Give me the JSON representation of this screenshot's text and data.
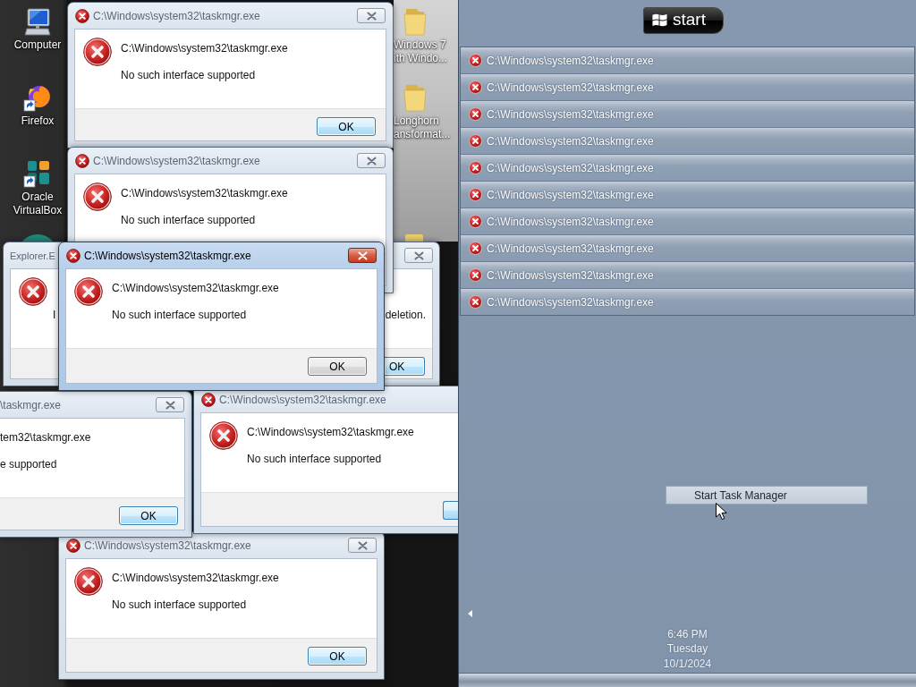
{
  "desktop": {
    "icons": [
      {
        "kind": "computer",
        "label": "Computer"
      },
      {
        "kind": "firefox",
        "label": "Firefox"
      },
      {
        "kind": "virtualbox",
        "label": "Oracle VirtualBox"
      },
      {
        "kind": "app-edge"
      },
      {
        "kind": "folder",
        "label_lines": [
          "Windows 7",
          "ith Windo..."
        ]
      },
      {
        "kind": "folder",
        "label_lines": [
          "Longhorn",
          "ansformat..."
        ]
      },
      {
        "kind": "folder-edge"
      }
    ]
  },
  "dialogs": [
    {
      "kind": "error",
      "active": false,
      "title": "C:\\Windows\\system32\\taskmgr.exe",
      "heading": "C:\\Windows\\system32\\taskmgr.exe",
      "message": "No such interface supported",
      "button": "OK"
    },
    {
      "kind": "error",
      "active": false,
      "title": "C:\\Windows\\system32\\taskmgr.exe",
      "heading": "C:\\Windows\\system32\\taskmgr.exe",
      "message": "No such interface supported"
    },
    {
      "kind": "explorer",
      "active": false,
      "title": "Explorer.E",
      "message_left": "I",
      "message_right": "deletion.",
      "button": "OK"
    },
    {
      "kind": "error",
      "active": true,
      "title": "C:\\Windows\\system32\\taskmgr.exe",
      "heading": "C:\\Windows\\system32\\taskmgr.exe",
      "message": "No such interface supported",
      "button": "OK"
    },
    {
      "kind": "clipped-left",
      "active": false,
      "title": "\\taskmgr.exe",
      "heading": "tem32\\taskmgr.exe",
      "message": "e supported",
      "button": "OK"
    },
    {
      "kind": "clipped-right",
      "active": false,
      "title": "C:\\Windows\\system32\\taskmgr.exe",
      "heading": "C:\\Windows\\system32\\taskmgr.exe",
      "message": "No such interface supported"
    },
    {
      "kind": "error",
      "active": false,
      "title": "C:\\Windows\\system32\\taskmgr.exe",
      "heading": "C:\\Windows\\system32\\taskmgr.exe",
      "message": "No such interface supported",
      "button": "OK"
    }
  ],
  "side_panel": {
    "start_button": "start",
    "items": [
      {
        "label": "C:\\Windows\\system32\\taskmgr.exe",
        "selected": false
      },
      {
        "label": "C:\\Windows\\system32\\taskmgr.exe",
        "selected": false
      },
      {
        "label": "C:\\Windows\\system32\\taskmgr.exe",
        "selected": false
      },
      {
        "label": "C:\\Windows\\system32\\taskmgr.exe",
        "selected": false
      },
      {
        "label": "C:\\Windows\\system32\\taskmgr.exe",
        "selected": false
      },
      {
        "label": "C:\\Windows\\system32\\taskmgr.exe",
        "selected": false
      },
      {
        "label": "C:\\Windows\\system32\\taskmgr.exe",
        "selected": false
      },
      {
        "label": "C:\\Windows\\system32\\taskmgr.exe",
        "selected": false
      },
      {
        "label": "C:\\Windows\\system32\\taskmgr.exe",
        "selected": false
      },
      {
        "label": "C:\\Windows\\system32\\taskmgr.exe",
        "selected": false
      }
    ],
    "task_manager_button": "Start Task Manager",
    "clock": {
      "time": "6:46 PM",
      "day": "Tuesday",
      "date": "10/1/2024"
    }
  }
}
